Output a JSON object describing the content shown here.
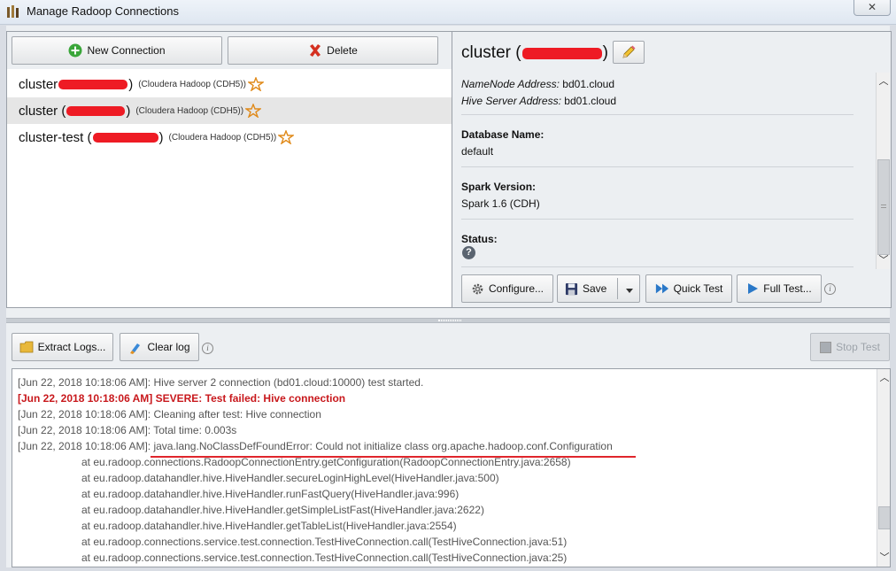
{
  "window": {
    "title": "Manage Radoop Connections",
    "close_glyph": "✕"
  },
  "toolbar": {
    "new_connection_label": "New Connection",
    "delete_label": "Delete"
  },
  "connections": [
    {
      "name_prefix": "cluster",
      "paren_open": "",
      "paren_close": ")",
      "type": "(Cloudera Hadoop (CDH5))"
    },
    {
      "name_prefix": "cluster (",
      "paren_open": "",
      "paren_close": ")",
      "type": "(Cloudera Hadoop (CDH5))"
    },
    {
      "name_prefix": "cluster-test (",
      "paren_open": "",
      "paren_close": ")",
      "type": "(Cloudera Hadoop (CDH5))"
    }
  ],
  "detail": {
    "title_prefix": "cluster (",
    "title_suffix": ")",
    "namenode_label": "NameNode Address:",
    "namenode_value": "bd01.cloud",
    "hive_label": "Hive Server Address:",
    "hive_value": "bd01.cloud",
    "database_label": "Database Name:",
    "database_value": "default",
    "spark_label": "Spark Version:",
    "spark_value": "Spark 1.6 (CDH)",
    "status_label": "Status:",
    "status_icon_glyph": "?"
  },
  "actions": {
    "configure_label": "Configure...",
    "save_label": "Save",
    "quick_test_label": "Quick Test",
    "full_test_label": "Full Test...",
    "info_glyph": "i"
  },
  "log_toolbar": {
    "extract_logs_label": "Extract Logs...",
    "clear_log_label": "Clear log",
    "stop_test_label": "Stop Test"
  },
  "log": [
    {
      "kind": "normal",
      "text": "[Jun 22, 2018 10:18:06 AM]: Hive server 2 connection (bd01.cloud:10000) test started."
    },
    {
      "kind": "error",
      "text": "[Jun 22, 2018 10:18:06 AM] SEVERE: Test failed: Hive connection"
    },
    {
      "kind": "normal",
      "text": "[Jun 22, 2018 10:18:06 AM]: Cleaning after test: Hive connection"
    },
    {
      "kind": "normal",
      "text": "[Jun 22, 2018 10:18:06 AM]: Total time: 0.003s"
    },
    {
      "kind": "normal",
      "text": "[Jun 22, 2018 10:18:06 AM]: java.lang.NoClassDefFoundError: Could not initialize class org.apache.hadoop.conf.Configuration"
    },
    {
      "kind": "trace",
      "text": "at eu.radoop.connections.RadoopConnectionEntry.getConfiguration(RadoopConnectionEntry.java:2658)"
    },
    {
      "kind": "trace",
      "text": "at eu.radoop.datahandler.hive.HiveHandler.secureLoginHighLevel(HiveHandler.java:500)"
    },
    {
      "kind": "trace",
      "text": "at eu.radoop.datahandler.hive.HiveHandler.runFastQuery(HiveHandler.java:996)"
    },
    {
      "kind": "trace",
      "text": "at eu.radoop.datahandler.hive.HiveHandler.getSimpleListFast(HiveHandler.java:2622)"
    },
    {
      "kind": "trace",
      "text": "at eu.radoop.datahandler.hive.HiveHandler.getTableList(HiveHandler.java:2554)"
    },
    {
      "kind": "trace",
      "text": "at eu.radoop.connections.service.test.connection.TestHiveConnection.call(TestHiveConnection.java:51)"
    },
    {
      "kind": "trace",
      "text": "at eu.radoop.connections.service.test.connection.TestHiveConnection.call(TestHiveConnection.java:25)"
    }
  ],
  "colors": {
    "redaction": "#ee1b24",
    "error_text": "#c8181c",
    "accent_blue": "#2a78c8"
  }
}
